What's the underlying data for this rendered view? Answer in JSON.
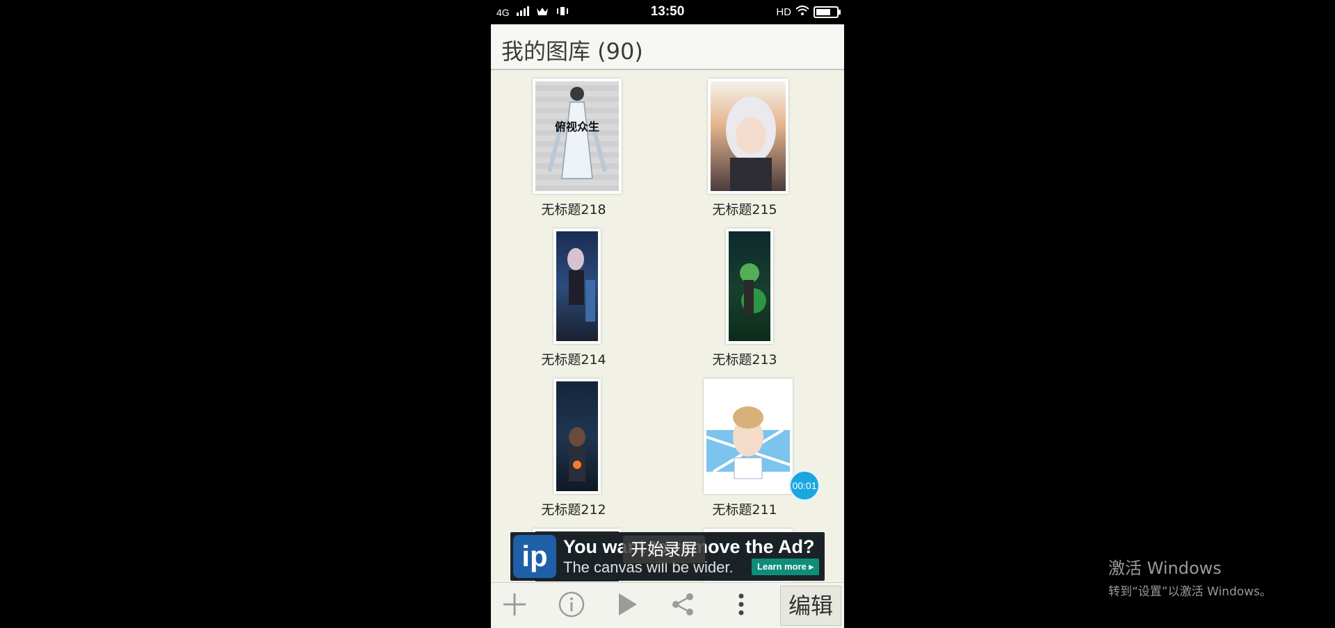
{
  "status_bar": {
    "network": "4G",
    "time": "13:50",
    "hd": "HD",
    "icons": [
      "signal-icon",
      "crown-icon",
      "vibrate-icon",
      "wifi-icon",
      "battery-icon"
    ]
  },
  "header": {
    "title": "我的图库 (90)"
  },
  "gallery": {
    "items": [
      {
        "caption": "无标题218",
        "overlay": "俯视众生"
      },
      {
        "caption": "无标题215"
      },
      {
        "caption": "无标题214"
      },
      {
        "caption": "无标题213"
      },
      {
        "caption": "无标题212"
      },
      {
        "caption": "无标题211"
      }
    ]
  },
  "ad": {
    "logo": "ip",
    "headline": "You want to remove the Ad?",
    "subline": "The canvas will be wider.",
    "button": "Learn more"
  },
  "recording": {
    "toast": "开始录屏",
    "timer": "00:01"
  },
  "toolbar": {
    "icons": [
      "add-icon",
      "info-icon",
      "play-icon",
      "share-icon",
      "more-icon"
    ],
    "edit_label": "编辑"
  },
  "watermark": {
    "line1": "激活 Windows",
    "line2": "转到“设置”以激活 Windows。"
  },
  "colors": {
    "background": "#f1f1e6",
    "ad_button": "#0f8d7a",
    "timer": "#1aa7e0"
  }
}
